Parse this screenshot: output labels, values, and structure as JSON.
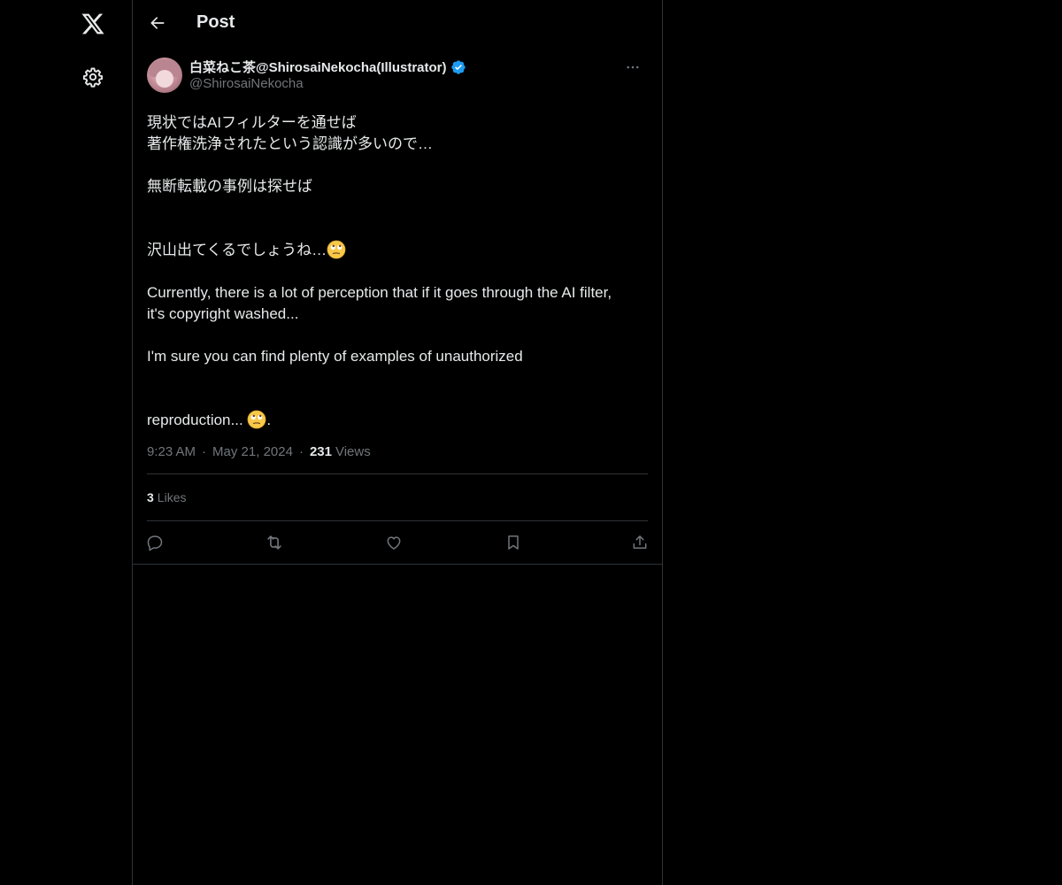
{
  "header": {
    "title": "Post"
  },
  "nav": {
    "logo": "x-logo-icon",
    "settings": "gear-icon"
  },
  "post": {
    "author": {
      "display_name": "白菜ねこ茶@ShirosaiNekocha(Illustrator)",
      "handle": "@ShirosaiNekocha",
      "verified": true
    },
    "lines": [
      "現状ではAIフィルターを通せば",
      "著作権洗浄されたという認識が多いので…",
      "",
      "無断転載の事例は探せば",
      "沢山出てくるでしょうね…",
      "",
      "Currently, there is a lot of perception that if it goes through the AI filter,",
      "it's copyright washed...",
      "",
      "I'm sure you can find plenty of examples of unauthorized",
      "reproduction..."
    ],
    "emoji_name": "face-with-rolling-eyes-icon",
    "line_5_emoji": true,
    "line_11_suffix": ".",
    "time": "9:23 AM",
    "date": "May 21, 2024",
    "views_count": "231",
    "views_label": "Views",
    "likes_count": "3",
    "likes_label": "Likes"
  },
  "colors": {
    "background": "#000000",
    "text": "#e7e9ea",
    "secondary": "#71767b",
    "border": "#2f3336",
    "verified": "#1d9bf0"
  }
}
